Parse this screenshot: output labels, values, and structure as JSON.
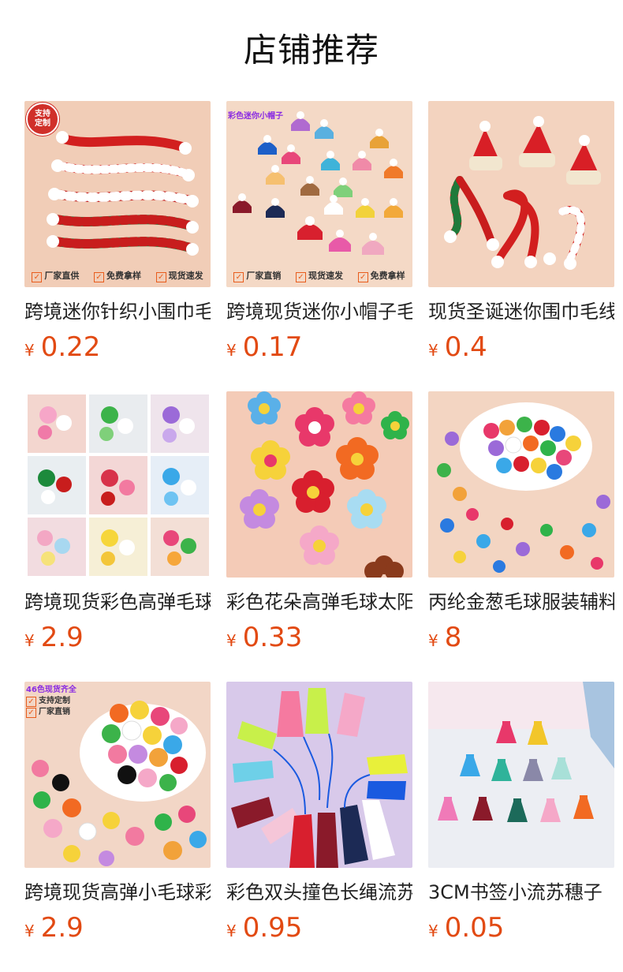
{
  "page": {
    "title": "店铺推荐"
  },
  "currency": "¥",
  "products": [
    {
      "name": "跨境迷你针织小围巾毛线圣诞装饰",
      "price": "0.22",
      "thumb_badge": [
        "支持",
        "定制"
      ],
      "thumb_strip": [
        "厂家直供",
        "免费拿样",
        "现货速发"
      ],
      "thumb_bg": "#f1cdb7"
    },
    {
      "name": "跨境现货迷你小帽子毛线针织小帽",
      "price": "0.17",
      "thumb_tag": "彩色迷你小帽子",
      "thumb_strip": [
        "厂家直销",
        "现货速发",
        "免费拿样"
      ],
      "thumb_bg": "#f4d9c6"
    },
    {
      "name": "现货圣诞迷你围巾毛线小帽子套装",
      "price": "0.4",
      "thumb_bg": "#f3d3bf"
    },
    {
      "name": "跨境现货彩色高弹毛球彩色绒球",
      "price": "2.9",
      "thumb_bg": "#f2d8c8"
    },
    {
      "name": "彩色花朵高弹毛球太阳花装饰",
      "price": "0.33",
      "thumb_bg": "#f4cbb7"
    },
    {
      "name": "丙纶金葱毛球服装辅料装饰",
      "price": "8",
      "thumb_bg": "#f3d5c2"
    },
    {
      "name": "跨境现货高弹小毛球彩色绒球",
      "price": "2.9",
      "thumb_tag_list": [
        "46色现货齐全",
        "支持定制",
        "厂家直销"
      ],
      "thumb_bg": "#f2d6c6"
    },
    {
      "name": "彩色双头撞色长绳流苏挂件",
      "price": "0.95",
      "thumb_bg": "#d8c9ea"
    },
    {
      "name": "3CM书签小流苏穗子",
      "price": "0.05",
      "thumb_bg": "#eceef3"
    }
  ]
}
